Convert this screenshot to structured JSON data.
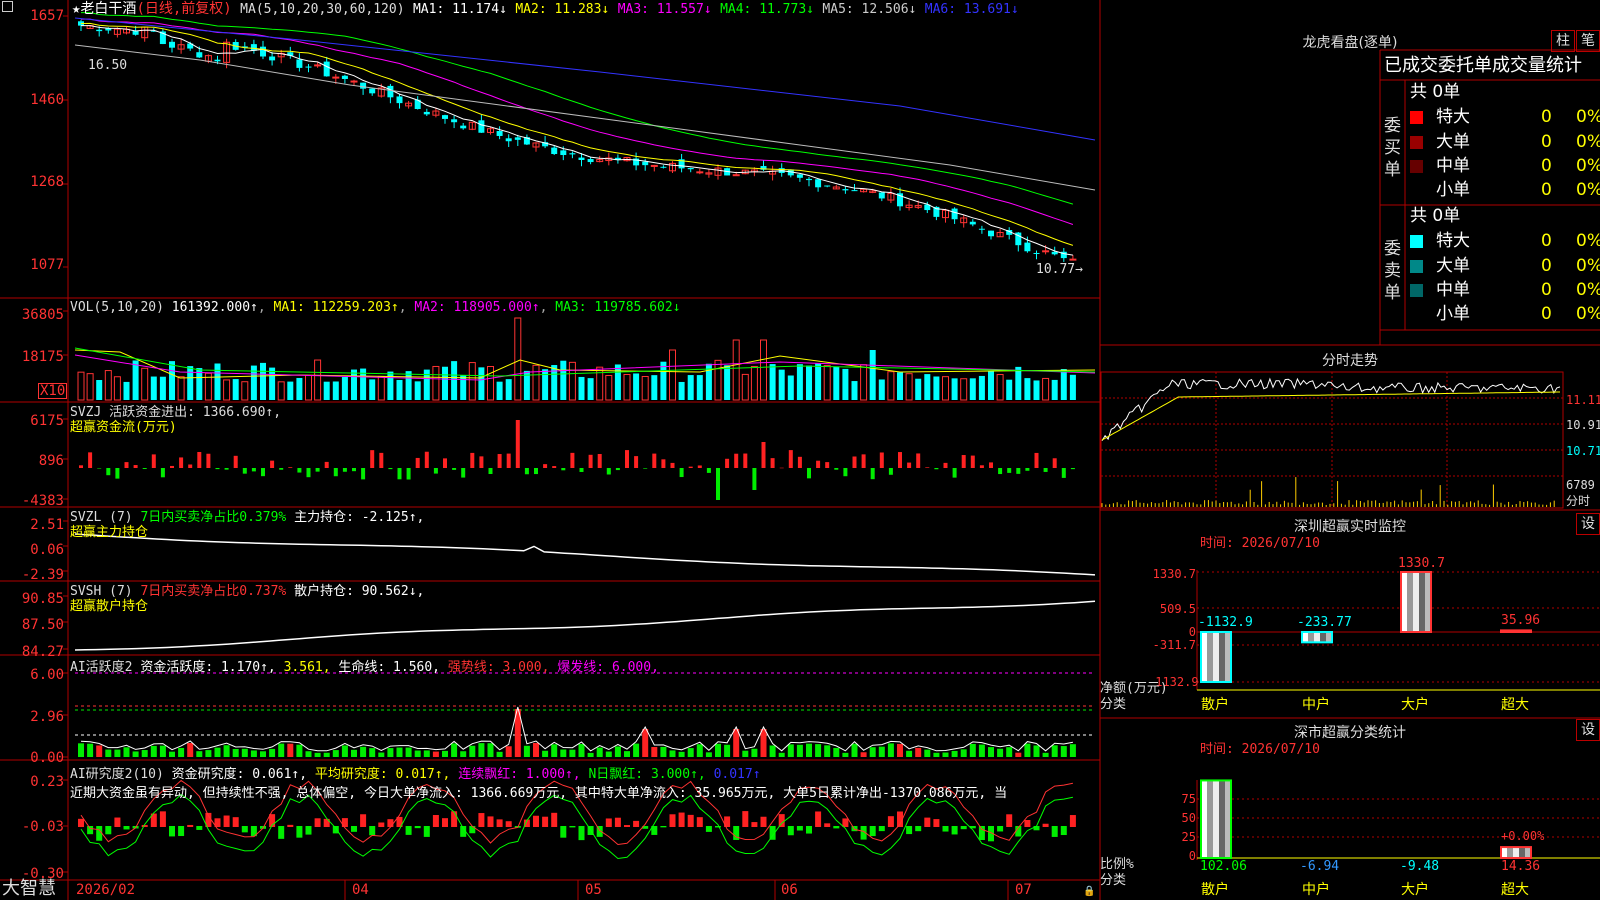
{
  "stock": {
    "name": "老白干酒",
    "period": "(日线,前复权)",
    "star": "★"
  },
  "price_panel": {
    "ma_header": "MA(5,10,20,30,60,120)",
    "ma": [
      {
        "label": "MA1: 11.174↓",
        "color": "#ffffff"
      },
      {
        "label": "MA2: 11.283↓",
        "color": "#ffff00"
      },
      {
        "label": "MA3: 11.557↓",
        "color": "#ff00ff"
      },
      {
        "label": "MA4: 11.773↓",
        "color": "#00ff00"
      },
      {
        "label": "MA5: 12.506↓",
        "color": "#cccccc"
      },
      {
        "label": "MA6: 13.691↓",
        "color": "#3333ff"
      }
    ],
    "yticks": [
      "1657",
      "1460",
      "1268",
      "1077"
    ],
    "high_mark": "16.50",
    "low_mark": "10.77→"
  },
  "vol_panel": {
    "header": "VOL(5,10,20)",
    "value": "161392.000↑",
    "ma1": "MA1: 112259.203↑",
    "ma2": "MA2: 118905.000↑",
    "ma3": "MA3: 119785.602↓",
    "yticks": [
      "36805",
      "18175"
    ],
    "unit": "X10"
  },
  "svzj_panel": {
    "header": "SVZJ  活跃资金进出: 1366.690↑,",
    "sub": "超赢资金流(万元)",
    "yticks": [
      "6175",
      "896",
      "-4383"
    ]
  },
  "svzl_panel": {
    "header": "SVZL (7)",
    "ratio": "7日内买卖净占比0.379%",
    "hold": "主力持仓: -2.125↑,",
    "sub": "超赢主力持仓",
    "yticks": [
      "2.51",
      "0.06",
      "-2.39"
    ]
  },
  "svsh_panel": {
    "header": "SVSH (7)",
    "ratio": "7日内买卖净占比0.737%",
    "hold": "散户持仓: 90.562↓,",
    "sub": "超赢散户持仓",
    "yticks": [
      "90.85",
      "87.50",
      "84.27"
    ]
  },
  "ai_active_panel": {
    "header": "AI活跃度2",
    "p1": "资金活跃度: 1.170↑,",
    "p2": "3.561,",
    "p3": "生命线: 1.560,",
    "p4": "强势线: 3.000,",
    "p5": "爆发线: 6.000,",
    "yticks": [
      "6.00",
      "2.96",
      "0.00"
    ]
  },
  "ai_research_panel": {
    "header": "AI研究度2(10)",
    "p1": "资金研究度: 0.061↑,",
    "p2": "平均研究度: 0.017↑,",
    "p3": "连续飘红: 1.000↑,",
    "p4": "N日飘红: 3.000↑,",
    "p5": "0.017↑",
    "note": "近期大资金虽有异动, 但持续性不强, 总体偏空, 今日大单净流入: 1366.669万元, 其中特大单净流入: 35.965万元, 大单5日累计净出-1370.086万元, 当",
    "yticks": [
      "0.23",
      "-0.03",
      "-0.30"
    ]
  },
  "bottom": {
    "logo": "大智慧",
    "dates": [
      "2026/02",
      "04",
      "05",
      "06",
      "07"
    ]
  },
  "right": {
    "dragon_title": "龙虎看盘(逐单)",
    "btn_zhu": "柱",
    "btn_bi": "笔",
    "stats_title": "已成交委托单成交量统计",
    "buy_side": {
      "label": "委买单",
      "total": "共 0单",
      "rows": [
        {
          "name": "特大",
          "count": "0",
          "pct": "0%",
          "color": "#ff0000"
        },
        {
          "name": "大单",
          "count": "0",
          "pct": "0%",
          "color": "#990000"
        },
        {
          "name": "中单",
          "count": "0",
          "pct": "0%",
          "color": "#660000"
        },
        {
          "name": "小单",
          "count": "0",
          "pct": "0%",
          "color": ""
        }
      ]
    },
    "sell_side": {
      "label": "委卖单",
      "total": "共 0单",
      "rows": [
        {
          "name": "特大",
          "count": "0",
          "pct": "0%",
          "color": "#00ffff"
        },
        {
          "name": "大单",
          "count": "0",
          "pct": "0%",
          "color": "#008888"
        },
        {
          "name": "中单",
          "count": "0",
          "pct": "0%",
          "color": "#006666"
        },
        {
          "name": "小单",
          "count": "0",
          "pct": "0%",
          "color": ""
        }
      ]
    },
    "intraday": {
      "title": "分时走势",
      "yticks": [
        "11.11",
        "10.91",
        "10.71"
      ],
      "vol_tick": "6789",
      "vol_label": "分时"
    },
    "monitor": {
      "title": "深圳超赢实时监控",
      "btn": "设",
      "time": "时间: 2026/07/10",
      "yticks": [
        "1330.7",
        "509.5",
        "0",
        "-311.7",
        "-1132.9"
      ],
      "axis_label1": "净额(万元)",
      "axis_label2": "分类",
      "values": [
        "-1132.9",
        "-233.77",
        "1330.7",
        "35.96"
      ],
      "categories": [
        "散户",
        "中户",
        "大户",
        "超大"
      ]
    },
    "classify": {
      "title": "深市超赢分类统计",
      "btn": "设",
      "time": "时间: 2026/07/10",
      "yticks": [
        "75",
        "50",
        "25",
        "0"
      ],
      "axis_label1": "比例%",
      "axis_label2": "分类",
      "values": [
        "102.06",
        "-6.94",
        "-9.48",
        "14.36"
      ],
      "top_label": "+0.00%",
      "categories": [
        "散户",
        "中户",
        "大户",
        "超大"
      ]
    }
  },
  "chart_data": [
    {
      "type": "candlestick",
      "title": "老白干酒 (日线,前复权)",
      "ylim": [
        10.77,
        16.5
      ],
      "yticks": [
        16.57,
        14.6,
        12.68,
        10.77
      ],
      "high": 16.5,
      "low": 10.77,
      "x_labels": [
        "2026/02",
        "04",
        "05",
        "06",
        "07"
      ]
    },
    {
      "type": "bar",
      "title": "VOL(5,10,20)",
      "last": 161392.0,
      "ma": [
        112259.203,
        118905.0,
        119785.602
      ],
      "yticks": [
        36805,
        18175
      ],
      "unit": "X10"
    },
    {
      "type": "bar",
      "title": "SVZJ 超赢资金流(万元)",
      "last": 1366.69,
      "yticks": [
        6175,
        896,
        -4383
      ]
    },
    {
      "type": "line",
      "title": "SVZL 超赢主力持仓",
      "last": -2.125,
      "yticks": [
        2.51,
        0.06,
        -2.39
      ]
    },
    {
      "type": "line",
      "title": "SVSH 超赢散户持仓",
      "last": 90.562,
      "yticks": [
        90.85,
        87.5,
        84.27
      ]
    },
    {
      "type": "bar",
      "title": "AI活跃度2",
      "series": [
        {
          "name": "资金活跃度",
          "last": 1.17
        },
        {
          "name": "生命线",
          "value": 1.56
        },
        {
          "name": "强势线",
          "value": 3.0
        },
        {
          "name": "爆发线",
          "value": 6.0
        }
      ],
      "yticks": [
        6.0,
        2.96,
        0.0
      ]
    },
    {
      "type": "bar",
      "title": "AI研究度2(10)",
      "series": [
        {
          "name": "资金研究度",
          "last": 0.061
        },
        {
          "name": "平均研究度",
          "last": 0.017
        }
      ],
      "yticks": [
        0.23,
        -0.03,
        -0.3
      ]
    },
    {
      "type": "bar",
      "title": "深圳超赢实时监控",
      "categories": [
        "散户",
        "中户",
        "大户",
        "超大"
      ],
      "values": [
        -1132.9,
        -233.77,
        1330.7,
        35.96
      ],
      "ylabel": "净额(万元)",
      "ylim": [
        -1132.9,
        1330.7
      ]
    },
    {
      "type": "bar",
      "title": "深市超赢分类统计",
      "categories": [
        "散户",
        "中户",
        "大户",
        "超大"
      ],
      "values": [
        102.06,
        -6.94,
        -9.48,
        14.36
      ],
      "ylabel": "比例%",
      "ylim": [
        0,
        100
      ]
    }
  ]
}
